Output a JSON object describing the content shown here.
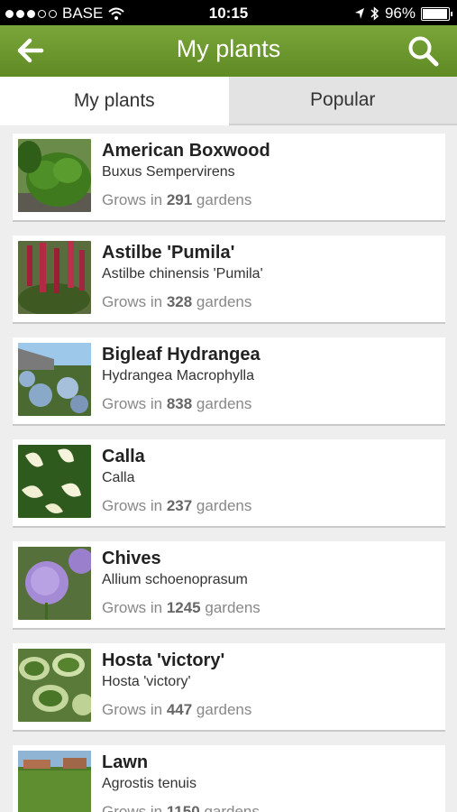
{
  "status_bar": {
    "carrier": "BASE",
    "time": "10:15",
    "battery": "96%",
    "battery_level": 0.96
  },
  "header": {
    "title": "My plants",
    "back_icon": "arrow-left-icon",
    "search_icon": "search-icon"
  },
  "tabs": [
    {
      "label": "My plants",
      "active": true
    },
    {
      "label": "Popular",
      "active": false
    }
  ],
  "plants": [
    {
      "name": "American Boxwood",
      "latin": "Buxus Sempervirens",
      "grows_prefix": "Grows in",
      "count": "291",
      "grows_suffix": "gardens"
    },
    {
      "name": "Astilbe 'Pumila'",
      "latin": "Astilbe chinensis 'Pumila'",
      "grows_prefix": "Grows in",
      "count": "328",
      "grows_suffix": "gardens"
    },
    {
      "name": "Bigleaf Hydrangea",
      "latin": "Hydrangea Macrophylla",
      "grows_prefix": "Grows in",
      "count": "838",
      "grows_suffix": "gardens"
    },
    {
      "name": "Calla",
      "latin": "Calla",
      "grows_prefix": "Grows in",
      "count": "237",
      "grows_suffix": "gardens"
    },
    {
      "name": "Chives",
      "latin": "Allium schoenoprasum",
      "grows_prefix": "Grows in",
      "count": "1245",
      "grows_suffix": "gardens"
    },
    {
      "name": "Hosta 'victory'",
      "latin": "Hosta 'victory'",
      "grows_prefix": "Grows in",
      "count": "447",
      "grows_suffix": "gardens"
    },
    {
      "name": "Lawn",
      "latin": "Agrostis tenuis",
      "grows_prefix": "Grows in",
      "count": "1150",
      "grows_suffix": "gardens"
    }
  ]
}
